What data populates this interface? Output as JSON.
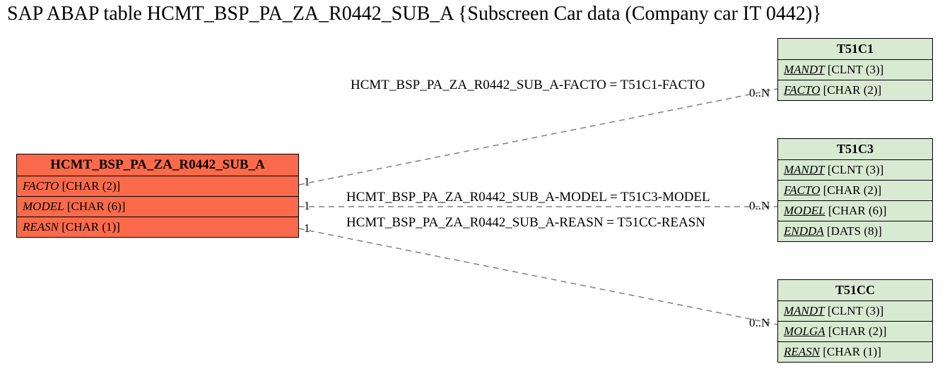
{
  "title": "SAP ABAP table HCMT_BSP_PA_ZA_R0442_SUB_A {Subscreen Car data (Company car IT 0442)}",
  "main": {
    "name": "HCMT_BSP_PA_ZA_R0442_SUB_A",
    "fields": {
      "f0": {
        "name": "FACTO",
        "type": "[CHAR (2)]"
      },
      "f1": {
        "name": "MODEL",
        "type": "[CHAR (6)]"
      },
      "f2": {
        "name": "REASN",
        "type": "[CHAR (1)]"
      }
    }
  },
  "t51c1": {
    "name": "T51C1",
    "fields": {
      "f0": {
        "name": "MANDT",
        "type": "[CLNT (3)]"
      },
      "f1": {
        "name": "FACTO",
        "type": "[CHAR (2)]"
      }
    }
  },
  "t51c3": {
    "name": "T51C3",
    "fields": {
      "f0": {
        "name": "MANDT",
        "type": "[CLNT (3)]"
      },
      "f1": {
        "name": "FACTO",
        "type": "[CHAR (2)]"
      },
      "f2": {
        "name": "MODEL",
        "type": "[CHAR (6)]"
      },
      "f3": {
        "name": "ENDDA",
        "type": "[DATS (8)]"
      }
    }
  },
  "t51cc": {
    "name": "T51CC",
    "fields": {
      "f0": {
        "name": "MANDT",
        "type": "[CLNT (3)]"
      },
      "f1": {
        "name": "MOLGA",
        "type": "[CHAR (2)]"
      },
      "f2": {
        "name": "REASN",
        "type": "[CHAR (1)]"
      }
    }
  },
  "relations": {
    "r0": "HCMT_BSP_PA_ZA_R0442_SUB_A-FACTO = T51C1-FACTO",
    "r1": "HCMT_BSP_PA_ZA_R0442_SUB_A-MODEL = T51C3-MODEL",
    "r2": "HCMT_BSP_PA_ZA_R0442_SUB_A-REASN = T51CC-REASN"
  },
  "cards": {
    "left": "1",
    "right": "0..N"
  }
}
